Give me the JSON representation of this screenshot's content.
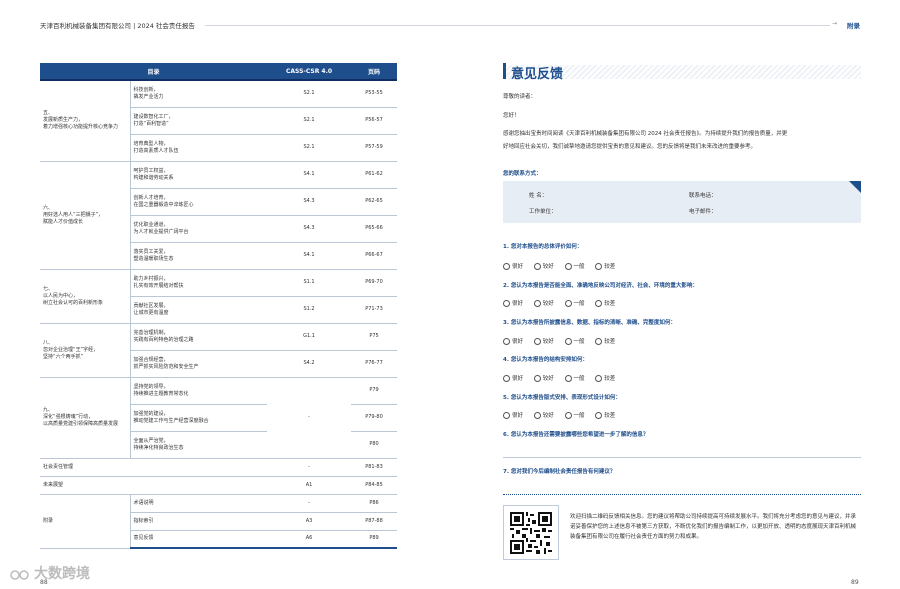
{
  "header": {
    "title": "天津百利机械装备集团有限公司 | 2024 社会责任报告",
    "tag": "附录"
  },
  "index_table": {
    "headers": [
      "目录",
      "CASS-CSR 4.0",
      "页码"
    ],
    "groups": [
      {
        "chapter": "五、\n发展新质生产力，\n着力增强核心功能提升核心竞争力",
        "rows": [
          {
            "section": "科技创新，\n撬发产业活力",
            "code": "S2.1",
            "page": "P53-55"
          },
          {
            "section": "建设数智化工厂，\n打造“百利智造”",
            "code": "S2.1",
            "page": "P56-57"
          },
          {
            "section": "培育典型人物，\n打造高素质人才队伍",
            "code": "S2.1",
            "page": "P57-59"
          }
        ]
      },
      {
        "chapter": "六、\n用好选人用人“三把镊子”，\n赋能人才价值成长",
        "rows": [
          {
            "section": "呵护员工权益，\n构建和谐劳动关系",
            "code": "S4.1",
            "page": "P61-62"
          },
          {
            "section": "创新人才培育，\n在国之重器锻造中淬炼匠心",
            "code": "S4.3",
            "page": "P62-65"
          },
          {
            "section": "优化职业通道，\n为人才就业提供广阔平台",
            "code": "S4.3",
            "page": "P65-66"
          },
          {
            "section": "落实员工关爱，\n塑造温暖职场生态",
            "code": "S4.1",
            "page": "P66-67"
          }
        ]
      },
      {
        "chapter": "七、\n以人民为中心，\n树立社会认可的百利新形象",
        "rows": [
          {
            "section": "助力乡村振兴，\n扎实有效开展结对帮扶",
            "code": "S1.1",
            "page": "P69-70"
          },
          {
            "section": "贡献社区发展，\n让城市更有温度",
            "code": "S1.2",
            "page": "P71-73"
          }
        ]
      },
      {
        "chapter": "八、\n忽对企业治理“王”字经，\n坚持“六个两手抓”",
        "rows": [
          {
            "section": "完善治理机制，\n实践有百利特色的治理之路",
            "code": "G1.1",
            "page": "P75"
          },
          {
            "section": "加强合规经营，\n抓严抓实风险防范和安全生产",
            "code": "S4.2",
            "page": "P76-77"
          }
        ]
      },
      {
        "chapter": "九、\n深化“强根铸魂”行动，\n以高质量党建引领保障高质量发展",
        "code_merged": "-",
        "rows": [
          {
            "section": "坚持党的领导，\n持续推进主题教育常态化",
            "page": "P79"
          },
          {
            "section": "加强党的建设，\n推动党建工作与生产经营深度融合",
            "page": "P79-80"
          },
          {
            "section": "全面从严治党，\n持续净化特良政治生态",
            "page": "P80"
          }
        ]
      },
      {
        "chapter_full": "社会责任管理",
        "code": "-",
        "page": "P81-83"
      },
      {
        "chapter_full": "未来展望",
        "code": "A1",
        "page": "P84-85"
      },
      {
        "chapter": "附录",
        "rows": [
          {
            "section": "术语说明",
            "code": "-",
            "page": "P86"
          },
          {
            "section": "指标索引",
            "code": "A3",
            "page": "P87-88"
          },
          {
            "section": "意见反馈",
            "code": "A6",
            "page": "P89"
          }
        ]
      }
    ]
  },
  "feedback": {
    "title": "意见反馈",
    "greeting": "尊敬的读者：",
    "hello": "您好！",
    "intro_1": "感谢您抽出宝贵时间阅读《天津百利机械装备集团有限公司 2024 社会责任报告》。为持续提升我们的报告质量，并更",
    "intro_2": "好地回应社会关切，我们诚挚地邀请您提供宝贵的意见和建议。您的反馈将是我们未来改进的重要参考。",
    "contact_title": "您的联系方式：",
    "contact_labels": {
      "name": "姓      名：",
      "phone": "联系电话：",
      "unit": "工作单位：",
      "email": "电子邮件："
    },
    "options": [
      "很好",
      "较好",
      "一般",
      "较差"
    ],
    "questions": [
      "1. 您对本报告的总体评价如何：",
      "2. 您认为本报告是否能全面、准确地反映公司对经济、社会、环境的重大影响：",
      "3. 您认为本报告所披露信息、数据、指标的清晰、准确、完整度如何：",
      "4. 您认为本报告的结构安排如何：",
      "5. 您认为本报告版式安排、表现形式设计如何：",
      "6. 您认为本报告还需要披露哪些您希望进一步了解的信息？",
      "7. 您对我们今后编制社会责任报告有何建议？"
    ],
    "closing": "欢迎扫描二维码反馈相关信息。您的建议将帮助公司持续提高可持续发展水平。我们将充分考虑您的意见与建议，并承诺妥善保护您的上述信息不被第三方获取，不断优化我们的报告编制工作，以更加开放、透明的态度展现天津百利机械装备集团有限公司在履行社会责任方面的努力和成果。"
  },
  "page_numbers": {
    "left": "88",
    "right": "89"
  },
  "watermark": "大数跨境",
  "colors": {
    "accent": "#1f4e8c",
    "row_rule": "#bcc7d6",
    "contact_bg": "#e7edf5"
  }
}
